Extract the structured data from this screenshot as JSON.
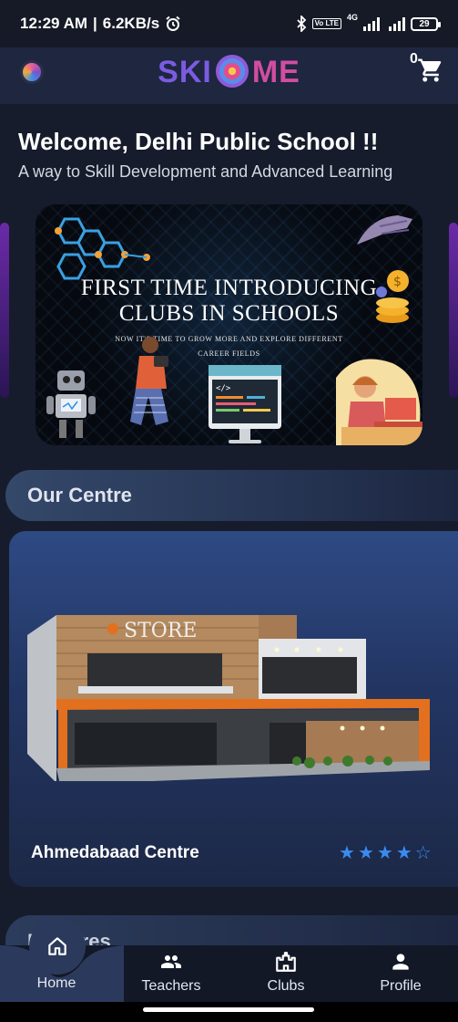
{
  "status_bar": {
    "time": "12:29 AM",
    "separator": "|",
    "speed": "6.2KB/s",
    "network": "4G",
    "lte": "Vo LTE",
    "battery": "29"
  },
  "header": {
    "brand_left": "SKI",
    "brand_right": "ME",
    "cart_count": "0"
  },
  "welcome": {
    "title": "Welcome, Delhi Public School !!",
    "subtitle": "A way to Skill Development and Advanced Learning"
  },
  "banner": {
    "title_line1": "FIRST TIME INTRODUCING",
    "title_line2": "CLUBS IN SCHOOLS",
    "sub_line1": "NOW IT'S TIME TO GROW MORE AND EXPLORE DIFFERENT",
    "sub_line2": "CAREER FIELDS",
    "store_sign": "STORE"
  },
  "our_centre": {
    "heading": "Our Centre",
    "card": {
      "name": "Ahmedabaad Centre",
      "rating": 4,
      "rating_max": 5
    }
  },
  "features": {
    "heading": "Features"
  },
  "bottom_nav": {
    "items": [
      {
        "label": "Home",
        "icon": "home-icon"
      },
      {
        "label": "Teachers",
        "icon": "people-icon"
      },
      {
        "label": "Clubs",
        "icon": "castle-icon"
      },
      {
        "label": "Profile",
        "icon": "person-icon"
      }
    ]
  },
  "colors": {
    "background": "#161c2b",
    "accent_star": "#3a8bf0",
    "brand_purple": "#7b5ce0",
    "brand_pink": "#d24da2"
  }
}
